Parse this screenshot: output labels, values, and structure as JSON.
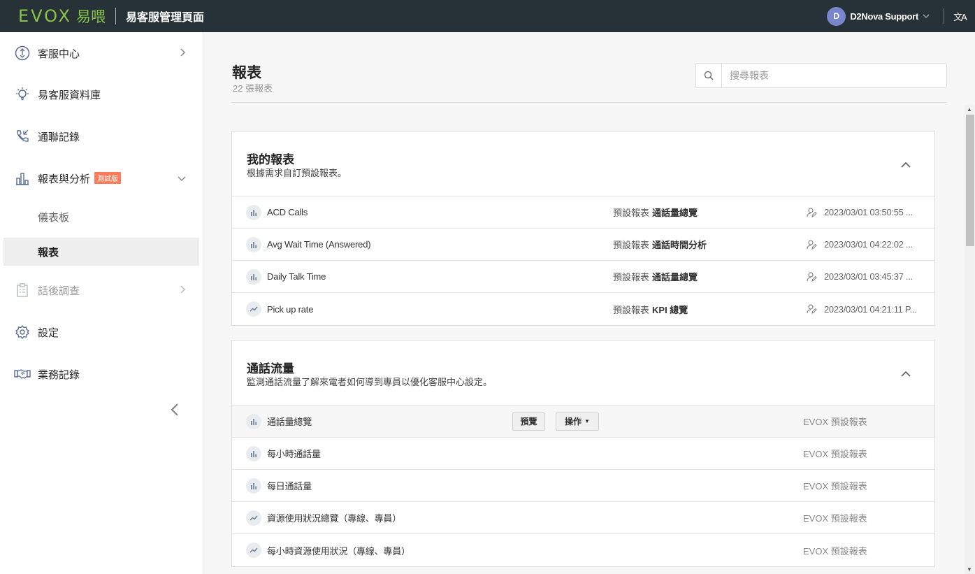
{
  "header": {
    "logo_text": "EVOX",
    "logo_cn": "易喂",
    "app_title": "易客服管理頁面",
    "user_initial": "D",
    "user_name": "D2Nova Support",
    "lang_icon_glyph": "文A"
  },
  "sidebar": {
    "items": [
      {
        "label": "客服中心",
        "icon": "support-center-icon"
      },
      {
        "label": "易客服資料庫",
        "icon": "lightbulb-icon"
      },
      {
        "label": "通聯記錄",
        "icon": "phone-log-icon"
      },
      {
        "label": "報表與分析",
        "icon": "bar-chart-icon",
        "badge": "測試版"
      },
      {
        "label": "話後調查",
        "icon": "survey-icon"
      },
      {
        "label": "設定",
        "icon": "gear-icon"
      },
      {
        "label": "業務記錄",
        "icon": "handshake-icon"
      }
    ],
    "subitems": [
      {
        "label": "儀表板"
      },
      {
        "label": "報表"
      }
    ]
  },
  "main": {
    "title": "報表",
    "count": "22 張報表",
    "search_placeholder": "搜尋報表"
  },
  "my_reports": {
    "title": "我的報表",
    "description": "根據需求自訂預設報表。",
    "rows": [
      {
        "name": "ACD Calls",
        "type_prefix": "預設報表",
        "type": "通話量總覽",
        "time": "2023/03/01 03:50:55 ...",
        "icon": "bar"
      },
      {
        "name": "Avg Wait Time (Answered)",
        "type_prefix": "預設報表",
        "type": "通話時間分析",
        "time": "2023/03/01 04:22:02 ...",
        "icon": "bar"
      },
      {
        "name": "Daily Talk Time",
        "type_prefix": "預設報表",
        "type": "通話量總覽",
        "time": "2023/03/01 03:45:37 ...",
        "icon": "bar"
      },
      {
        "name": "Pick up rate",
        "type_prefix": "預設報表",
        "type": "KPI 總覽",
        "time": "2023/03/01 04:21:11 P...",
        "icon": "line"
      }
    ]
  },
  "call_traffic": {
    "title": "通話流量",
    "description": "監測通話流量了解來電者如何導到專員以優化客服中心設定。",
    "preview_label": "預覽",
    "action_label": "操作",
    "rows": [
      {
        "name": "通話量總覽",
        "source": "EVOX 預設報表",
        "icon": "bar"
      },
      {
        "name": "每小時通話量",
        "source": "EVOX 預設報表",
        "icon": "bar"
      },
      {
        "name": "每日通話量",
        "source": "EVOX 預設報表",
        "icon": "bar"
      },
      {
        "name": "資源使用狀況總覽（專線、專員）",
        "source": "EVOX 預設報表",
        "icon": "line"
      },
      {
        "name": "每小時資源使用狀況（專線、專員）",
        "source": "EVOX 預設報表",
        "icon": "line"
      }
    ]
  },
  "colors": {
    "topbar": "#263238",
    "brand_green": "#8bc34a",
    "beta_badge": "#ff7a59",
    "avatar": "#7986cb"
  }
}
